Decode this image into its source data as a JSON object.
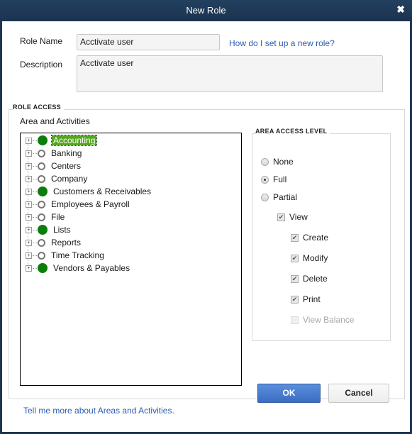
{
  "window": {
    "title": "New Role",
    "close_icon": "close-x-icon"
  },
  "form": {
    "role_name_label": "Role Name",
    "role_name_value": "Acctivate user",
    "description_label": "Description",
    "description_value": "Acctivate user",
    "help_link": "How do I set up a new role?"
  },
  "role_access": {
    "title": "ROLE ACCESS",
    "areas_label": "Area and Activities",
    "areas": [
      {
        "label": "Accounting",
        "access": "full",
        "selected": true
      },
      {
        "label": "Banking",
        "access": "none"
      },
      {
        "label": "Centers",
        "access": "none"
      },
      {
        "label": "Company",
        "access": "none"
      },
      {
        "label": "Customers & Receivables",
        "access": "full"
      },
      {
        "label": "Employees & Payroll",
        "access": "none"
      },
      {
        "label": "File",
        "access": "none"
      },
      {
        "label": "Lists",
        "access": "full"
      },
      {
        "label": "Reports",
        "access": "none"
      },
      {
        "label": "Time Tracking",
        "access": "none"
      },
      {
        "label": "Vendors & Payables",
        "access": "full"
      }
    ]
  },
  "access_level": {
    "title": "AREA ACCESS LEVEL",
    "options": [
      {
        "label": "None",
        "selected": false
      },
      {
        "label": "Full",
        "selected": true
      },
      {
        "label": "Partial",
        "selected": false
      }
    ],
    "view": {
      "label": "View",
      "checked": true
    },
    "activities": [
      {
        "label": "Create",
        "checked": true,
        "disabled": false
      },
      {
        "label": "Modify",
        "checked": true,
        "disabled": false
      },
      {
        "label": "Delete",
        "checked": true,
        "disabled": false
      },
      {
        "label": "Print",
        "checked": true,
        "disabled": false
      },
      {
        "label": "View Balance",
        "checked": false,
        "disabled": true
      }
    ]
  },
  "footer": {
    "help_link": "Tell me more about Areas and Activities.",
    "ok_label": "OK",
    "cancel_label": "Cancel"
  }
}
